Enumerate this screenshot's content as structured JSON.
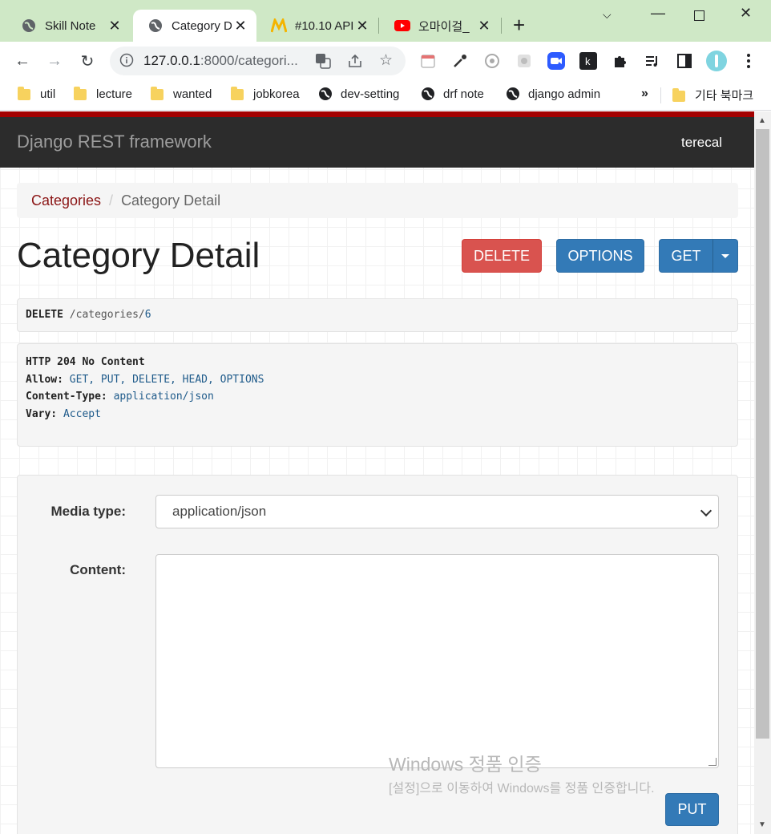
{
  "browser": {
    "tabs": [
      {
        "title": "Skill Note",
        "icon": "globe-icon"
      },
      {
        "title": "Category D",
        "icon": "globe-icon",
        "active": true
      },
      {
        "title": "#10.10 API",
        "icon": "nomad-logo-icon"
      },
      {
        "title": "오마이걸_",
        "icon": "youtube-icon"
      }
    ],
    "url": {
      "host": "127.0.0.1",
      "rest": ":8000/categori..."
    },
    "bookmarks": [
      {
        "label": "util",
        "icon": "folder-icon"
      },
      {
        "label": "lecture",
        "icon": "folder-icon"
      },
      {
        "label": "wanted",
        "icon": "folder-icon"
      },
      {
        "label": "jobkorea",
        "icon": "folder-icon"
      },
      {
        "label": "dev-setting",
        "icon": "globe-icon"
      },
      {
        "label": "drf note",
        "icon": "globe-icon"
      },
      {
        "label": "django admin",
        "icon": "globe-icon"
      }
    ],
    "more_bookmarks": "»",
    "other_bookmarks": "기타 북마크"
  },
  "navbar": {
    "brand": "Django REST framework",
    "user": "terecal"
  },
  "breadcrumb": {
    "parent": "Categories",
    "separator": "/",
    "current": "Category Detail"
  },
  "page": {
    "title": "Category Detail",
    "buttons": {
      "delete": "DELETE",
      "options": "OPTIONS",
      "get": "GET"
    }
  },
  "request": {
    "method": "DELETE",
    "path_prefix": "/categories/",
    "path_id": "6"
  },
  "response": {
    "status": "HTTP 204 No Content",
    "headers": [
      {
        "key": "Allow:",
        "value": "GET, PUT, DELETE, HEAD, OPTIONS"
      },
      {
        "key": "Content-Type:",
        "value": "application/json"
      },
      {
        "key": "Vary:",
        "value": "Accept"
      }
    ]
  },
  "form": {
    "media_type_label": "Media type:",
    "media_type_value": "application/json",
    "content_label": "Content:",
    "content_value": "",
    "submit": "PUT"
  },
  "watermark": {
    "line1": "Windows 정품 인증",
    "line2": "[설정]으로 이동하여 Windows를 정품 인증합니다."
  },
  "colors": {
    "tabstrip": "#cfe8c6",
    "navbar": "#2c2c2c",
    "accent_red": "#a30000",
    "primary": "#337ab7",
    "danger": "#d9534f"
  }
}
